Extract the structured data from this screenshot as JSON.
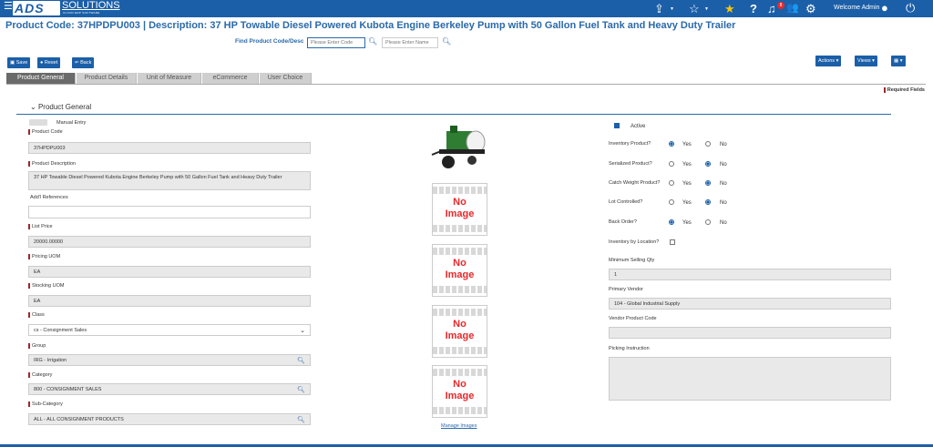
{
  "header": {
    "logo_main": "ADS",
    "logo_solutions": "SOLUTIONS",
    "logo_tagline": "CLOUD ERP SOFTWARE",
    "notifications_count": "8",
    "welcome": "Welcome Admin"
  },
  "page_title": "Product Code:  37HPDPU003 | Description: 37 HP Towable Diesel Powered Kubota Engine Berkeley Pump with 50 Gallon Fuel Tank and Heavy Duty Trailer",
  "find": {
    "label": "Find Product Code/Desc",
    "code_placeholder": "Please Enter Code",
    "name_placeholder": "Please Enter Name"
  },
  "toolbar": {
    "save": "Save",
    "reset": "Reset",
    "back": "Back",
    "actions": "Actions",
    "views": "Views"
  },
  "tabs": [
    "Product General",
    "Product Details",
    "Unit of Measure",
    "eCommerce",
    "User Choice"
  ],
  "required_fields": "Required Fields",
  "section_title": "Product General",
  "left": {
    "manual_entry": "Manual Entry",
    "product_code_label": "Product Code",
    "product_code": "37HPDPU003",
    "product_desc_label": "Product Description",
    "product_desc": "37 HP Towable Diesel Powered Kubota Engine Berkeley Pump with 50 Gallon Fuel Tank and Heavy Duty Trailer",
    "add_ref_label": "Add'l References",
    "add_ref": "",
    "list_price_label": "List Price",
    "list_price": "20000.00000",
    "pricing_uom_label": "Pricing UOM",
    "pricing_uom": "EA",
    "stocking_uom_label": "Stocking UOM",
    "stocking_uom": "EA",
    "class_label": "Class",
    "class": "cs - Consignment Sales",
    "group_label": "Group",
    "group": "IRG - Irrigation",
    "category_label": "Category",
    "category": "800 - CONSIGNMENT SALES",
    "subcategory_label": "Sub-Category",
    "subcategory": "ALL - ALL CONSIGNMENT PRODUCTS"
  },
  "images": {
    "no_image": "No\nImage",
    "manage": "Manage Images"
  },
  "right": {
    "active_label": "Active",
    "yes": "Yes",
    "no": "No",
    "inventory_product_label": "Inventory Product?",
    "serialized_product_label": "Serialized Product?",
    "catch_weight_label": "Catch Weight Product?",
    "lot_controlled_label": "Lot Controlled?",
    "back_order_label": "Back Order?",
    "inventory_by_location_label": "Inventory by Location?",
    "min_selling_qty_label": "Minimum Selling Qty",
    "min_selling_qty": "1",
    "primary_vendor_label": "Primary Vendor",
    "primary_vendor": "104 - Global Industrial Supply",
    "vendor_product_code_label": "Vendor Product Code",
    "vendor_product_code": "",
    "picking_instruction_label": "Picking Instruction",
    "picking_instruction": ""
  },
  "states": {
    "active": true,
    "inventory_product": "yes",
    "serialized_product": "no",
    "catch_weight": "no",
    "lot_controlled": "no",
    "back_order": "yes",
    "inventory_by_location": false
  },
  "colors": {
    "brand_blue": "#1b5fa8",
    "required_marker": "#a0282b",
    "no_image_red": "#e8282b"
  }
}
